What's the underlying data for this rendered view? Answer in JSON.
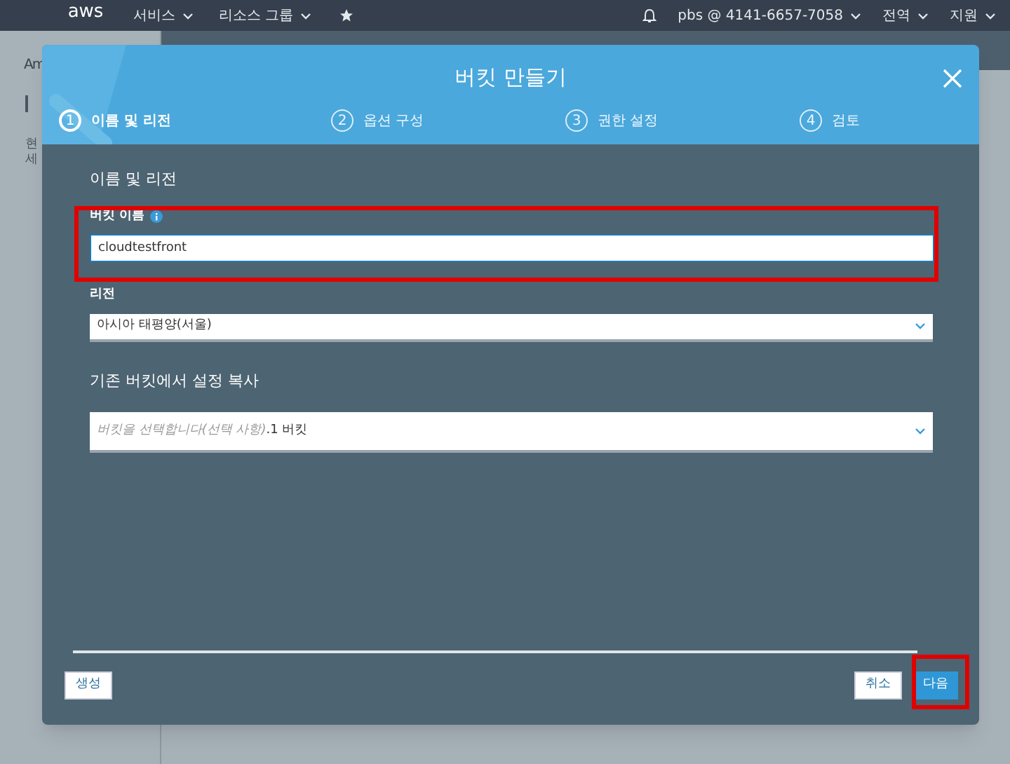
{
  "topnav": {
    "logo": "aws",
    "menus": [
      {
        "label": "서비스"
      },
      {
        "label": "리소스 그룹"
      }
    ],
    "account": "pbs @ 4141-6657-7058",
    "region": "전역",
    "support": "지원"
  },
  "sidebar": {
    "title": "Am",
    "text_lines": [
      "현",
      "세"
    ]
  },
  "dialog": {
    "title": "버킷 만들기",
    "steps": [
      {
        "number": "1",
        "label": "이름 및 리전",
        "selected": true
      },
      {
        "number": "2",
        "label": "옵션 구성",
        "selected": false
      },
      {
        "number": "3",
        "label": "권한 설정",
        "selected": false
      },
      {
        "number": "4",
        "label": "검토",
        "selected": false
      }
    ],
    "section_title": "이름 및 리전",
    "bucket_name": {
      "label": "버킷 이름",
      "value": "cloudtestfront"
    },
    "region": {
      "label": "리전",
      "value": "아시아 태평양(서울)"
    },
    "copy_section_title": "기존 버킷에서 설정 복사",
    "copy_select": {
      "placeholder": "버킷을 선택합니다(선택 사항)",
      "count": ".1 버킷"
    },
    "buttons": [
      {
        "kind": "secondary",
        "label": "생성"
      },
      {
        "kind": "secondary",
        "label": "취소"
      },
      {
        "kind": "primary",
        "label": "다음"
      }
    ]
  }
}
